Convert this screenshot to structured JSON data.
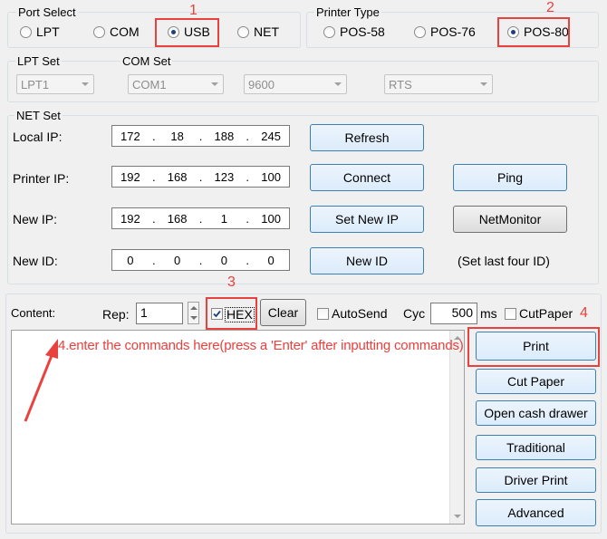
{
  "port_select": {
    "title": "Port Select",
    "options": [
      "LPT",
      "COM",
      "USB",
      "NET"
    ],
    "selected": "USB"
  },
  "printer_type": {
    "title": "Printer Type",
    "options": [
      "POS-58",
      "POS-76",
      "POS-80"
    ],
    "selected": "POS-80"
  },
  "lpt_set": {
    "title": "LPT Set",
    "value": "LPT1"
  },
  "com_set": {
    "title": "COM Set",
    "port": "COM1",
    "baud": "9600",
    "flow": "RTS"
  },
  "net_set": {
    "title": "NET Set",
    "local_ip": {
      "label": "Local IP:",
      "octets": [
        "172",
        "18",
        "188",
        "245"
      ]
    },
    "printer_ip": {
      "label": "Printer IP:",
      "octets": [
        "192",
        "168",
        "123",
        "100"
      ]
    },
    "new_ip": {
      "label": "New IP:",
      "octets": [
        "192",
        "168",
        "1",
        "100"
      ]
    },
    "new_id": {
      "label": "New ID:",
      "octets": [
        "0",
        "0",
        "0",
        "0"
      ]
    },
    "buttons": {
      "refresh": "Refresh",
      "connect": "Connect",
      "ping": "Ping",
      "set_new_ip": "Set New IP",
      "net_monitor": "NetMonitor",
      "new_id": "New ID"
    },
    "new_id_hint": "(Set last four ID)"
  },
  "content": {
    "label": "Content:",
    "rep_label": "Rep:",
    "rep_value": "1",
    "hex_label": "HEX",
    "hex_checked": true,
    "clear_label": "Clear",
    "autosend_label": "AutoSend",
    "autosend_checked": false,
    "cyc_label": "Cyc",
    "cyc_value": "500",
    "ms_label": "ms",
    "cutpaper_label": "CutPaper",
    "cutpaper_checked": false
  },
  "actions": {
    "print": "Print",
    "cut_paper": "Cut Paper",
    "open_cash_drawer": "Open cash drawer",
    "traditional": "Traditional",
    "driver_print": "Driver Print",
    "advanced": "Advanced"
  },
  "annotations": {
    "n1": "1",
    "n2": "2",
    "n3": "3",
    "n4": "4",
    "instruction": "4.enter the commands here(press a 'Enter' after inputting commands)",
    "color": "#e8413e"
  }
}
